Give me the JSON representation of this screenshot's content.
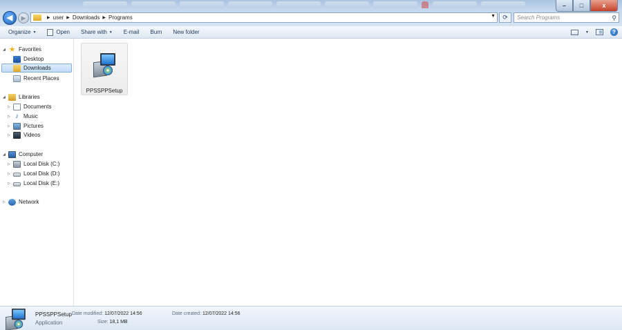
{
  "window": {
    "minimize_label": "–",
    "maximize_label": "□",
    "close_label": "x"
  },
  "address": {
    "path": [
      "user",
      "Downloads",
      "Programs"
    ],
    "search_placeholder": "Search Programs"
  },
  "toolbar": {
    "organize": "Organize",
    "open": "Open",
    "share_with": "Share with",
    "email": "E-mail",
    "burn": "Burn",
    "new_folder": "New folder"
  },
  "nav": {
    "favorites": "Favorites",
    "desktop": "Desktop",
    "downloads": "Downloads",
    "recent_places": "Recent Places",
    "libraries": "Libraries",
    "documents": "Documents",
    "music": "Music",
    "pictures": "Pictures",
    "videos": "Videos",
    "computer": "Computer",
    "disk_c": "Local Disk (C:)",
    "disk_d": "Local Disk (D:)",
    "disk_e": "Local Disk (E:)",
    "network": "Network",
    "selected": "Downloads"
  },
  "files": [
    {
      "name": "PPSSPPSetup",
      "icon": "installer-icon"
    }
  ],
  "details": {
    "name": "PPSSPPSetup",
    "type": "Application",
    "date_modified_label": "Date modified:",
    "date_modified": "12/07/2022 14:56",
    "size_label": "Size:",
    "size": "18,1 MB",
    "date_created_label": "Date created:",
    "date_created": "12/07/2022 14:56"
  },
  "colors": {
    "accent": "#1c5fb8",
    "selection": "#c1dcf8"
  }
}
